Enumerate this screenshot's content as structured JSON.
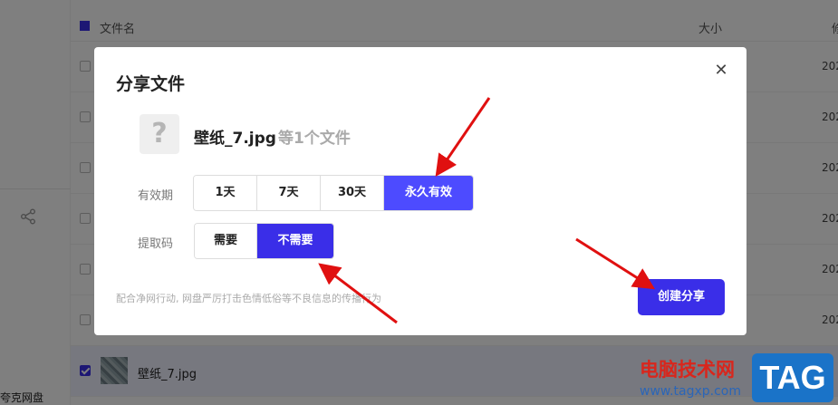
{
  "sidebar": {
    "brand_partial": "夸克网盘",
    "share_icon": "share-icon"
  },
  "file_list": {
    "header": {
      "name": "文件名",
      "size": "大小",
      "modified_partial": "修"
    },
    "rows": [
      {
        "date_partial": "202",
        "selected": false
      },
      {
        "date_partial": "202",
        "selected": false
      },
      {
        "date_partial": "202",
        "selected": false
      },
      {
        "date_partial": "202",
        "selected": false
      },
      {
        "date_partial": "202",
        "selected": false
      },
      {
        "date_partial": "202",
        "selected": false
      },
      {
        "name": "壁纸_7.jpg",
        "selected": true
      }
    ]
  },
  "dialog": {
    "title": "分享文件",
    "close_icon": "close-icon",
    "file_icon_glyph": "?",
    "file_name": "壁纸_7.jpg",
    "file_suffix": "等1个文件",
    "validity_label": "有效期",
    "validity_options": [
      "1天",
      "7天",
      "30天",
      "永久有效"
    ],
    "validity_selected": "永久有效",
    "code_label": "提取码",
    "code_options": [
      "需要",
      "不需要"
    ],
    "code_selected": "不需要",
    "notice": "配合净网行动, 网盘严厉打击色情低俗等不良信息的传播行为",
    "create_button": "创建分享"
  },
  "watermark": {
    "site": "电脑技术网",
    "url": "www.tagxp.com",
    "logo": "TAG"
  },
  "colors": {
    "primary": "#3a2ee8",
    "validity_active": "#4d4bff",
    "arrow": "#e01010"
  }
}
